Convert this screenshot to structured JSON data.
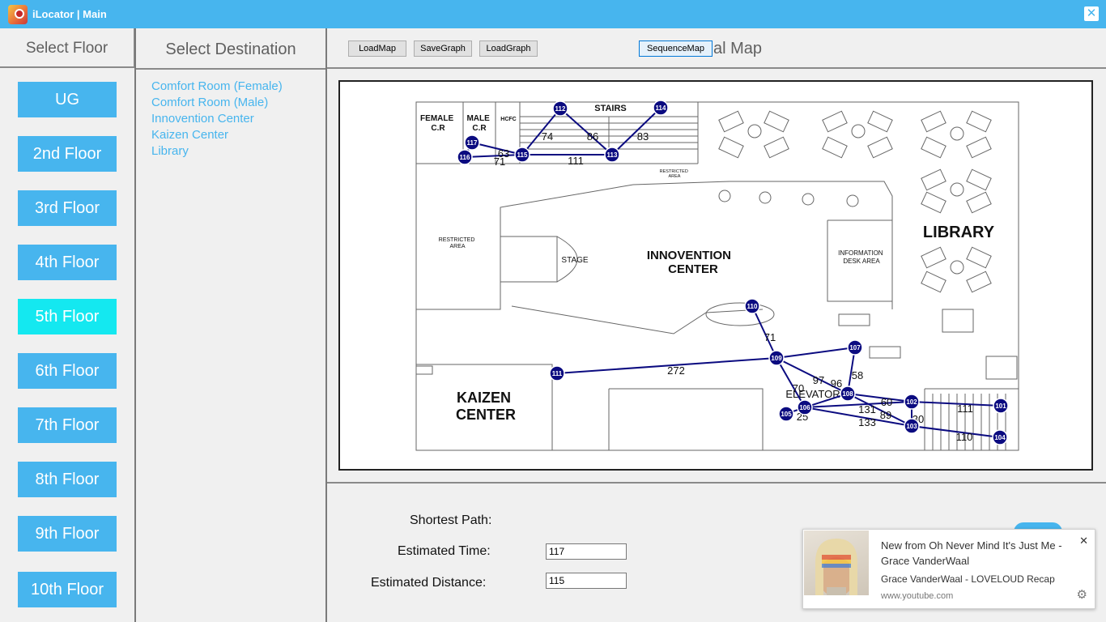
{
  "window": {
    "title": "iLocator | Main",
    "close_glyph": "✕"
  },
  "floors": {
    "header": "Select Floor",
    "items": [
      "UG",
      "2nd Floor",
      "3rd Floor",
      "4th Floor",
      "5th Floor",
      "6th Floor",
      "7th Floor",
      "8th Floor",
      "9th Floor",
      "10th Floor"
    ],
    "active": "5th Floor"
  },
  "destinations": {
    "header": "Select Destination",
    "items": [
      "Comfort Room (Female)",
      "Comfort Room (Male)",
      "Innovention Center",
      "Kaizen Center",
      "Library"
    ]
  },
  "toolbar": {
    "load_map": "LoadMap",
    "save_graph": "SaveGraph",
    "load_graph": "LoadGraph",
    "sequence_map": "SequenceMap",
    "map_title_visible": "al Map"
  },
  "map": {
    "labels": {
      "female_cr": "FEMALE\nC.R",
      "male_cr": "MALE\nC.R",
      "hcfc": "HCFC",
      "stairs": "STAIRS",
      "restricted_top": "RESTRICTED\nAREA",
      "restricted_left": "RESTRICTED\nAREA",
      "stage": "STAGE",
      "innovention": "INNOVENTION\nCENTER",
      "info_desk": "INFORMATION\nDESK AREA",
      "library": "LIBRARY",
      "kaizen": "KAIZEN\nCENTER",
      "elevator": "ELEVATOR"
    },
    "nodes": [
      "117",
      "112",
      "114",
      "116",
      "115",
      "113",
      "110",
      "109",
      "107",
      "111",
      "106",
      "105",
      "108",
      "102",
      "103",
      "101",
      "104"
    ],
    "edge_weights": [
      "74",
      "86",
      "83",
      "63",
      "71",
      "111",
      "71",
      "272",
      "70",
      "97",
      "96",
      "58",
      "25",
      "60",
      "131",
      "89",
      "30",
      "133",
      "111",
      "110"
    ],
    "node_color": "#0b0b80",
    "edge_color": "#0b0b80"
  },
  "results": {
    "shortest_path_label": "Shortest Path:",
    "time_label": "Estimated Time:",
    "time_value": "117",
    "distance_label": "Estimated Distance:",
    "distance_value": "115"
  },
  "notification": {
    "title": "New from Oh Never Mind It's Just Me - Grace VanderWaal",
    "subtitle": "Grace VanderWaal - LOVELOUD Recap",
    "url": "www.youtube.com",
    "close_glyph": "✕",
    "gear_glyph": "⚙"
  },
  "colors": {
    "accent": "#47b5ee",
    "active_floor": "#14e8f0",
    "link": "#47b5ee"
  }
}
